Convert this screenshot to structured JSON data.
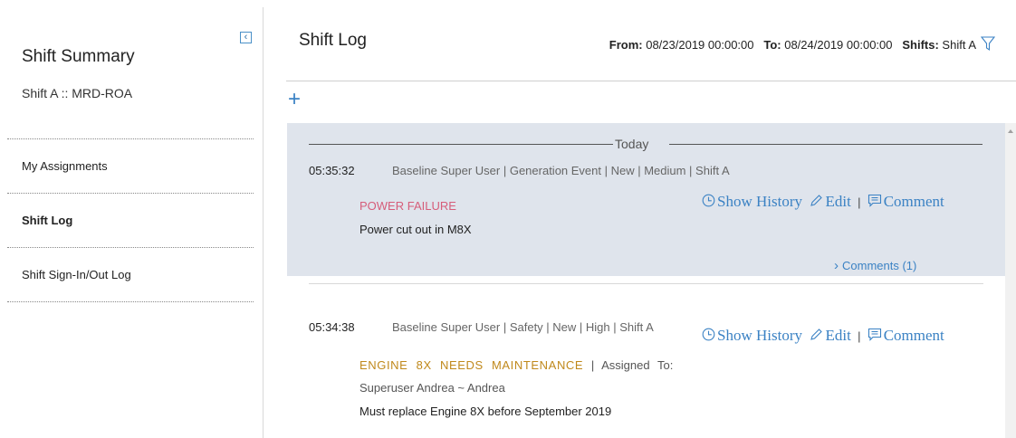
{
  "sidebar": {
    "collapse_glyph": "‹",
    "title": "Shift Summary",
    "subtitle": "Shift A :: MRD-ROA",
    "items": [
      {
        "label": "My Assignments",
        "active": false
      },
      {
        "label": "Shift Log",
        "active": true
      },
      {
        "label": "Shift Sign-In/Out Log",
        "active": false
      }
    ]
  },
  "header": {
    "title": "Shift Log",
    "from_label": "From:",
    "from_value": "08/23/2019 00:00:00",
    "to_label": "To:",
    "to_value": "08/24/2019 00:00:00",
    "shifts_label": "Shifts:",
    "shifts_value": "Shift A",
    "add_glyph": "+"
  },
  "log": {
    "today_label": "Today",
    "actions": {
      "history": "Show  History",
      "edit": "Edit",
      "separator": "|",
      "comment": "Comment"
    },
    "entries": [
      {
        "time": "05:35:32",
        "meta": "Baseline Super User | Generation Event | New | Medium | Shift A",
        "event": "POWER FAILURE",
        "description": "Power cut out in M8X",
        "comments": "Comments (1)"
      },
      {
        "time": "05:34:38",
        "meta": "Baseline Super User | Safety | New | High | Shift A",
        "event": "ENGINE 8X NEEDS MAINTENANCE",
        "assigned_sep": "|",
        "assigned_label": "Assigned To:",
        "assigned_to": "Superuser Andrea ~ Andrea",
        "description": "Must replace Engine 8X before September 2019"
      }
    ]
  },
  "colors": {
    "accent": "#3b82c4",
    "selected_entry_bg": "#dfe4ec",
    "event_medium": "#d65d7a",
    "event_high": "#c0891c"
  }
}
